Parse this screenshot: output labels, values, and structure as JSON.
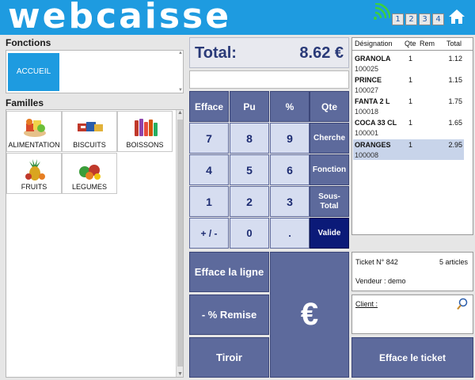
{
  "header": {
    "logo": "webcaisse",
    "tabs": [
      "1",
      "2",
      "3",
      "4"
    ]
  },
  "left": {
    "fonctions_label": "Fonctions",
    "fonctions_items": [
      "ACCUEIL"
    ],
    "familles_label": "Familles",
    "familles": [
      {
        "label": "ALIMENTATION",
        "icon": "food-icon"
      },
      {
        "label": "BISCUITS",
        "icon": "biscuits-icon"
      },
      {
        "label": "BOISSONS",
        "icon": "drinks-icon"
      },
      {
        "label": "FRUITS",
        "icon": "pineapple-icon"
      },
      {
        "label": "LEGUMES",
        "icon": "vegetables-icon"
      }
    ]
  },
  "total": {
    "label": "Total:",
    "value": "8.62 €"
  },
  "keypad": {
    "row1": [
      "Efface",
      "Pu",
      "%",
      "Qte"
    ],
    "row2": [
      "7",
      "8",
      "9",
      "Cherche"
    ],
    "row3": [
      "4",
      "5",
      "6",
      "Fonction"
    ],
    "row4": [
      "1",
      "2",
      "3",
      "Sous-",
      "Total"
    ],
    "row5": [
      "+ / -",
      "0",
      ".",
      "Valide"
    ]
  },
  "actions": {
    "efface_ligne": "Efface la ligne",
    "remise": "- % Remise",
    "tiroir": "Tiroir",
    "pay_symbol": "€",
    "efface_ticket": "Efface le ticket"
  },
  "ticket": {
    "headers": [
      "Désignation",
      "Qte",
      "Rem",
      "Total"
    ],
    "rows": [
      {
        "name": "GRANOLA",
        "qty": "1",
        "total": "1.12",
        "code": "100025",
        "selected": false
      },
      {
        "name": "PRINCE",
        "qty": "1",
        "total": "1.15",
        "code": "100027",
        "selected": false
      },
      {
        "name": "FANTA 2 L",
        "qty": "1",
        "total": "1.75",
        "code": "100018",
        "selected": false
      },
      {
        "name": "COCA 33 CL",
        "qty": "1",
        "total": "1.65",
        "code": "100001",
        "selected": false
      },
      {
        "name": "ORANGES",
        "qty": "1",
        "total": "2.95",
        "code": "100008",
        "selected": true
      }
    ],
    "number": "Ticket N° 842",
    "articles": "5 articles",
    "vendeur": "Vendeur : demo",
    "client_label": "Client :"
  },
  "colors": {
    "brand_blue": "#1e9be0",
    "key_light": "#d6ddf0",
    "key_dark": "#5d6a9c",
    "valide": "#0b1a78",
    "selected_row": "#c8d4ea"
  }
}
